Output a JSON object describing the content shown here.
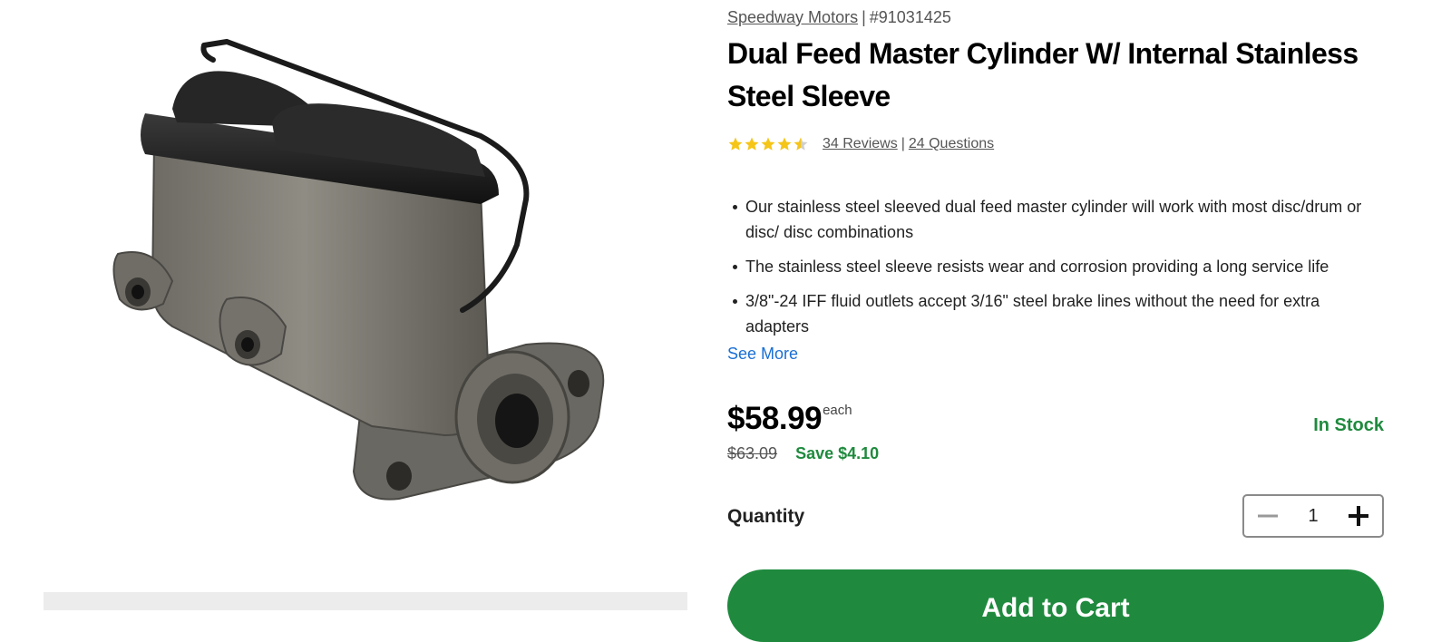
{
  "product": {
    "brand": "Speedway Motors",
    "sku": "#91031425",
    "title": "Dual Feed Master Cylinder W/ Internal Stainless Steel Sleeve",
    "rating": 4.5,
    "reviews_label": "34 Reviews",
    "questions_label": "24 Questions",
    "features": [
      "Our stainless steel sleeved dual feed master cylinder will work with most disc/drum or disc/ disc combinations",
      "The stainless steel sleeve resists wear and corrosion providing a long service life",
      "3/8\"-24 IFF fluid outlets accept 3/16\" steel brake lines without the need for extra adapters"
    ],
    "see_more_label": "See More",
    "price": "$58.99",
    "price_unit": "each",
    "was_price": "$63.09",
    "save_label": "Save $4.10",
    "stock_status": "In Stock",
    "quantity_label": "Quantity",
    "quantity_value": "1",
    "add_to_cart_label": "Add to Cart"
  },
  "separator": "|",
  "colors": {
    "accent_green": "#1f8a3e",
    "link_blue": "#1a6fd4",
    "star_gold": "#f5c518"
  },
  "icons": {
    "star": "star-icon",
    "minus": "minus-icon",
    "plus": "plus-icon"
  }
}
